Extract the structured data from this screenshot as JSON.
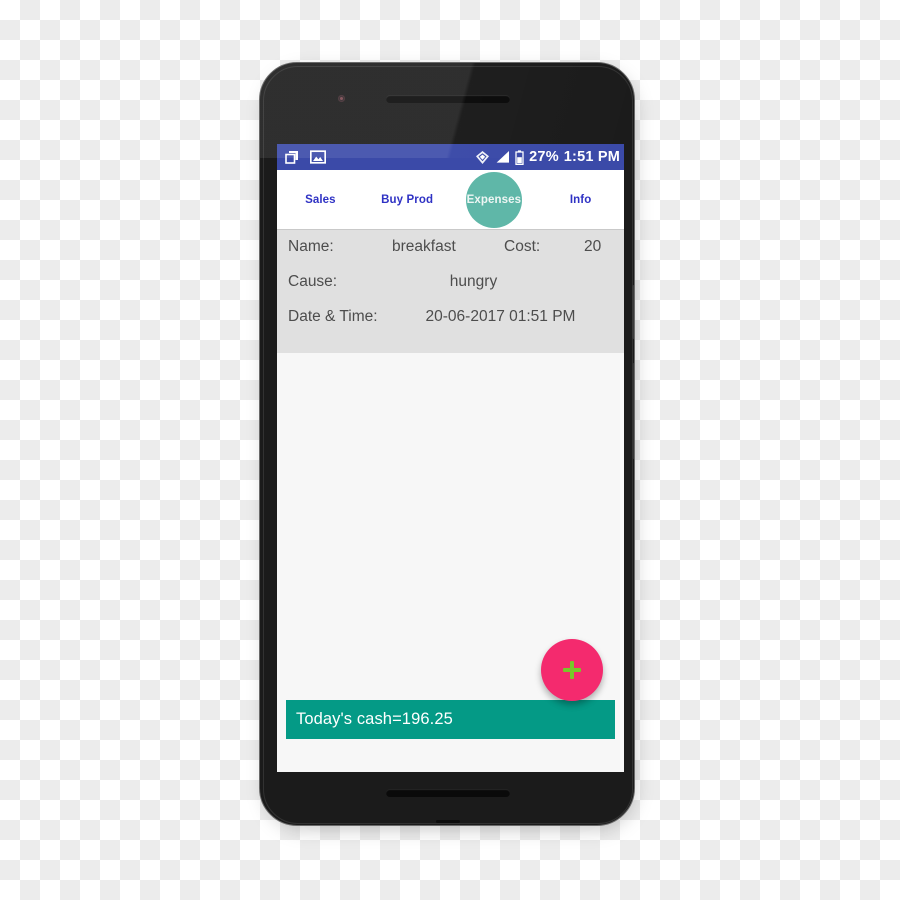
{
  "status_bar": {
    "left_icons": [
      "windows-stack-icon",
      "image-icon"
    ],
    "right_icons": [
      "diamond-gem-icon",
      "signal-triangle-icon",
      "battery-icon"
    ],
    "battery_percent": "27%",
    "time": "1:51 PM",
    "background_color": "#3b4aa8"
  },
  "tabs": {
    "items": [
      {
        "label": "Sales",
        "active": false
      },
      {
        "label": "Buy Prod",
        "active": false
      },
      {
        "label": "Expenses",
        "active": true
      },
      {
        "label": "Info",
        "active": false
      }
    ],
    "inactive_color": "#2f32c4",
    "active_circle_color": "#5fb7a8"
  },
  "detail_panel": {
    "background_color": "#e0e0e0",
    "rows": [
      {
        "label": "Name:",
        "value": "breakfast",
        "secondary_label": "Cost:",
        "secondary_value": "20"
      },
      {
        "label": "Cause:",
        "value": "hungry"
      },
      {
        "label": "Date & Time:",
        "value": "20-06-2017 01:51 PM"
      }
    ]
  },
  "fab": {
    "icon": "plus-icon",
    "background_color": "#f42a6e",
    "icon_color": "#78c72a"
  },
  "cash_bar": {
    "text": "Today's cash=196.25",
    "background_color": "#049a86",
    "text_color": "#ffffff"
  }
}
